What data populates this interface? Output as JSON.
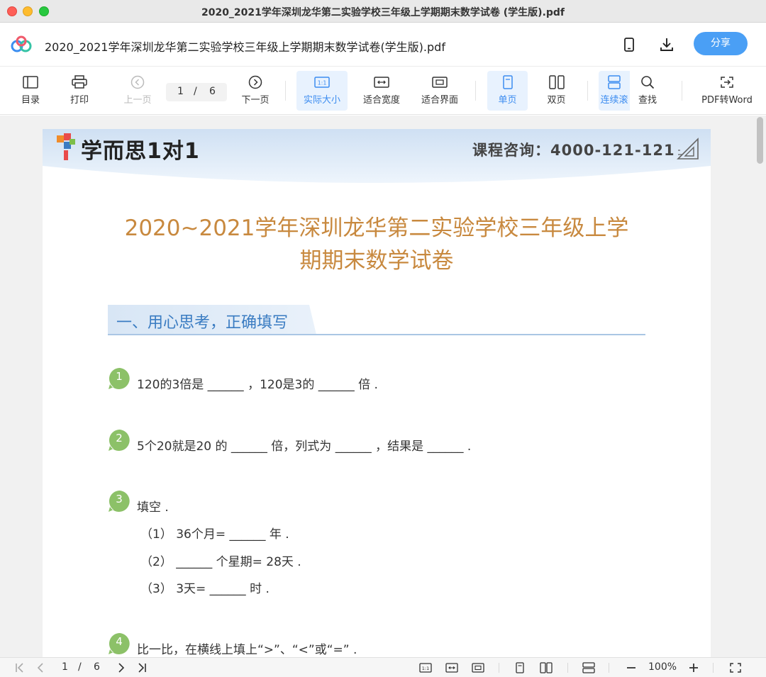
{
  "window": {
    "title": "2020_2021学年深圳龙华第二实验学校三年级上学期期末数学试卷 (学生版).pdf"
  },
  "header": {
    "doc_title": "2020_2021学年深圳龙华第二实验学校三年级上学期期末数学试卷(学生版).pdf",
    "share_label": "分享"
  },
  "toolbar": {
    "toc_label": "目录",
    "print_label": "打印",
    "prev_label": "上一页",
    "current_page": "1",
    "page_sep": "/",
    "total_pages": "6",
    "next_label": "下一页",
    "actual_size_label": "实际大小",
    "fit_width_label": "适合宽度",
    "fit_page_label": "适合界面",
    "single_label": "单页",
    "double_label": "双页",
    "continuous_label": "连续滚",
    "search_label": "查找",
    "convert_label": "PDF转Word"
  },
  "document": {
    "brand": "学而思1对1",
    "consult": "课程咨询：4000-121-121",
    "title_line1": "2020~2021学年深圳龙华第二实验学校三年级上学",
    "title_line2": "期期末数学试卷",
    "section1_title": "一、用心思考，正确填写",
    "questions": [
      {
        "num": "1",
        "text": "120的3倍是 ______ ，120是3的 ______ 倍 ."
      },
      {
        "num": "2",
        "text": "5个20就是20 的 ______ 倍，列式为 ______ ，结果是 ______  ."
      },
      {
        "num": "3",
        "text": "填空 .",
        "subs": [
          "（1）  36个月= ______ 年 .",
          "（2）  ______ 个星期= 28天 .",
          "（3）  3天= ______ 时 ."
        ]
      },
      {
        "num": "4",
        "text": "比一比，在横线上填上“>”、“<”或“=” ."
      }
    ]
  },
  "statusbar": {
    "current_page": "1",
    "page_sep": "/",
    "total_pages": "6",
    "zoom": "100%"
  },
  "colors": {
    "accent": "#4a9ff5",
    "title_orange": "#c8893f",
    "section_blue": "#3a7cc2",
    "badge_green": "#8cc168"
  }
}
